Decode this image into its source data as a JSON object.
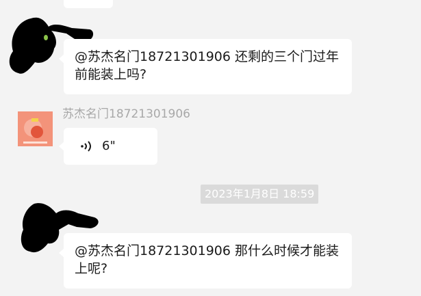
{
  "messages": [
    {
      "text": "@苏杰名门18721301906 还剩的三个门过年前能装上吗?"
    },
    {
      "sender": "苏杰名门18721301906",
      "voice": {
        "duration": "6\""
      }
    },
    {
      "timestamp": "2023年1月8日 18:59"
    },
    {
      "text": "@苏杰名门18721301906 那什么时候才能装上呢?"
    }
  ],
  "colors": {
    "background": "#f3f3f3",
    "bubble": "#ffffff",
    "timestamp_bg": "#dadada",
    "sender_name": "#a8a8a8"
  }
}
